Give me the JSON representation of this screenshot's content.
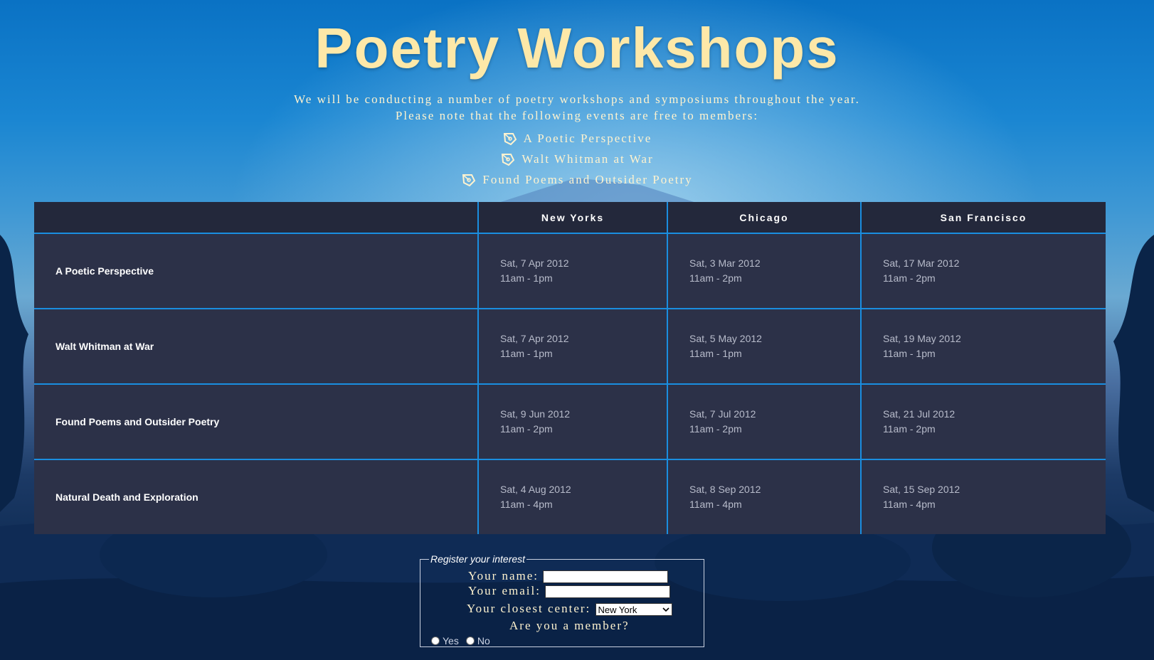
{
  "page": {
    "title": "Poetry Workshops",
    "intro_line1": "We will be conducting a number of poetry workshops and symposiums throughout the year.",
    "intro_line2": "Please note that the following events are free to members:"
  },
  "free_events": [
    "A Poetic Perspective",
    "Walt Whitman at War",
    "Found Poems and Outsider Poetry"
  ],
  "schedule": {
    "columns": [
      "",
      "New Yorks",
      "Chicago",
      "San Francisco"
    ],
    "rows": [
      {
        "event": "A Poetic Perspective",
        "slots": [
          {
            "date": "Sat, 7 Apr 2012",
            "time": "11am - 1pm"
          },
          {
            "date": "Sat, 3 Mar 2012",
            "time": "11am - 2pm"
          },
          {
            "date": "Sat, 17 Mar 2012",
            "time": "11am - 2pm"
          }
        ]
      },
      {
        "event": "Walt Whitman at War",
        "slots": [
          {
            "date": "Sat, 7 Apr 2012",
            "time": "11am - 1pm"
          },
          {
            "date": "Sat, 5 May 2012",
            "time": "11am - 1pm"
          },
          {
            "date": "Sat, 19 May 2012",
            "time": "11am - 1pm"
          }
        ]
      },
      {
        "event": "Found Poems and Outsider Poetry",
        "slots": [
          {
            "date": "Sat, 9 Jun 2012",
            "time": "11am - 2pm"
          },
          {
            "date": "Sat, 7 Jul 2012",
            "time": "11am - 2pm"
          },
          {
            "date": "Sat, 21 Jul 2012",
            "time": "11am - 2pm"
          }
        ]
      },
      {
        "event": "Natural Death and Exploration",
        "slots": [
          {
            "date": "Sat, 4 Aug 2012",
            "time": "11am - 4pm"
          },
          {
            "date": "Sat, 8 Sep 2012",
            "time": "11am - 4pm"
          },
          {
            "date": "Sat, 15 Sep 2012",
            "time": "11am - 4pm"
          }
        ]
      }
    ]
  },
  "form": {
    "legend": "Register your interest",
    "name_label": "Your name:",
    "name_value": "",
    "email_label": "Your email:",
    "email_value": "",
    "center_label": "Your closest center:",
    "center_selected": "New York",
    "member_label": "Are you a member?",
    "option_yes": "Yes",
    "option_no": "No"
  },
  "colors": {
    "title": "#fde8a8",
    "header_bg": "#23283b",
    "row_bg": "#2c3148",
    "grid_line": "#1a8ee0"
  },
  "icons": {
    "list_bullet": "pen-nib-icon",
    "select_arrow": "chevron-down-icon"
  }
}
